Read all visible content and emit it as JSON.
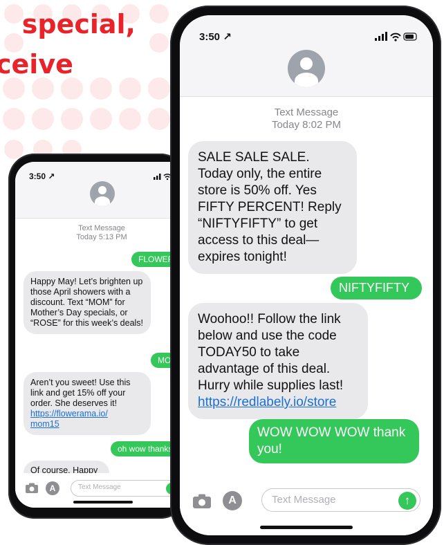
{
  "headline": {
    "line1": "special,",
    "line2": "ceive"
  },
  "colors": {
    "accent": "#e8232a",
    "imessage_green": "#34c759",
    "bubble_gray": "#e9e9eb",
    "link": "#1a6fd6"
  },
  "icons": {
    "camera": "camera-icon",
    "appstore": "appstore-icon",
    "send": "send-arrow-icon"
  },
  "phone_small": {
    "time": "3:50 ↗",
    "meta_line1": "Text Message",
    "meta_line2": "Today 5:13 PM",
    "messages": [
      {
        "dir": "out",
        "text": "FLOWERS"
      },
      {
        "dir": "in",
        "text": "Happy May! Let’s brighten up those April showers with a discount. Text “MOM” for Mother’s Day specials, or “ROSE” for this week’s deals!"
      },
      {
        "dir": "out",
        "text": "MOM"
      },
      {
        "dir": "in",
        "text": "Aren’t you sweet! Use this link and get 15% off your order. She deserves it!",
        "link": "https://flowerama.io/\nmom15"
      },
      {
        "dir": "out",
        "text": "oh wow thanks"
      },
      {
        "dir": "in",
        "text": "Of course. Happy Mother’s Day!"
      }
    ],
    "input_placeholder": "Text Message",
    "send_glyph": "↑"
  },
  "phone_big": {
    "time": "3:50 ↗",
    "meta_line1": "Text Message",
    "meta_line2": "Today 8:02 PM",
    "messages": [
      {
        "dir": "in",
        "text": "SALE SALE SALE. Today only, the entire store is 50% off. Yes FIFTY PERCENT! Reply “NIFTYFIFTY” to get access to this deal—expires tonight!"
      },
      {
        "dir": "out",
        "text": "NIFTYFIFTY"
      },
      {
        "dir": "in",
        "text": "Woohoo!! Follow the link below and use the code TODAY50 to take advantage of this deal. Hurry while supplies last!",
        "link": "https://redlabely.io/store"
      },
      {
        "dir": "out",
        "text": "WOW WOW WOW thank you!"
      }
    ],
    "input_placeholder": "Text Message",
    "send_glyph": "↑"
  }
}
